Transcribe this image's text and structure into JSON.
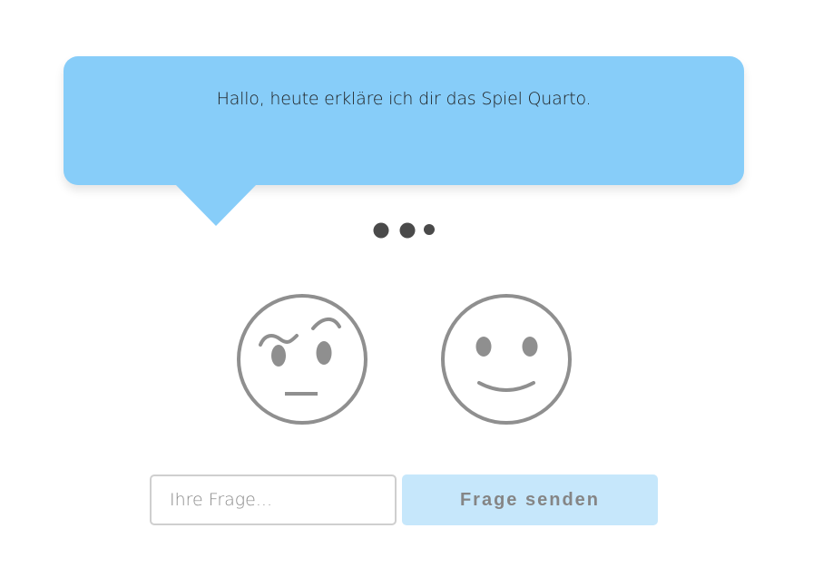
{
  "speech_bubble": {
    "text": "Hallo, heute erkläre ich dir das Spiel Quarto.",
    "background_color": "#87cdf9"
  },
  "typing_indicator": {
    "dot_color": "#4a4a4a",
    "dot_count": 3
  },
  "faces": {
    "left": {
      "icon": "skeptical-face-icon"
    },
    "right": {
      "icon": "smiling-face-icon"
    },
    "stroke_color": "#8f8f8f"
  },
  "question_form": {
    "input_placeholder": "Ihre Frage...",
    "input_value": "",
    "send_label": "Frage senden",
    "send_button_color": "#c6e7fb"
  }
}
